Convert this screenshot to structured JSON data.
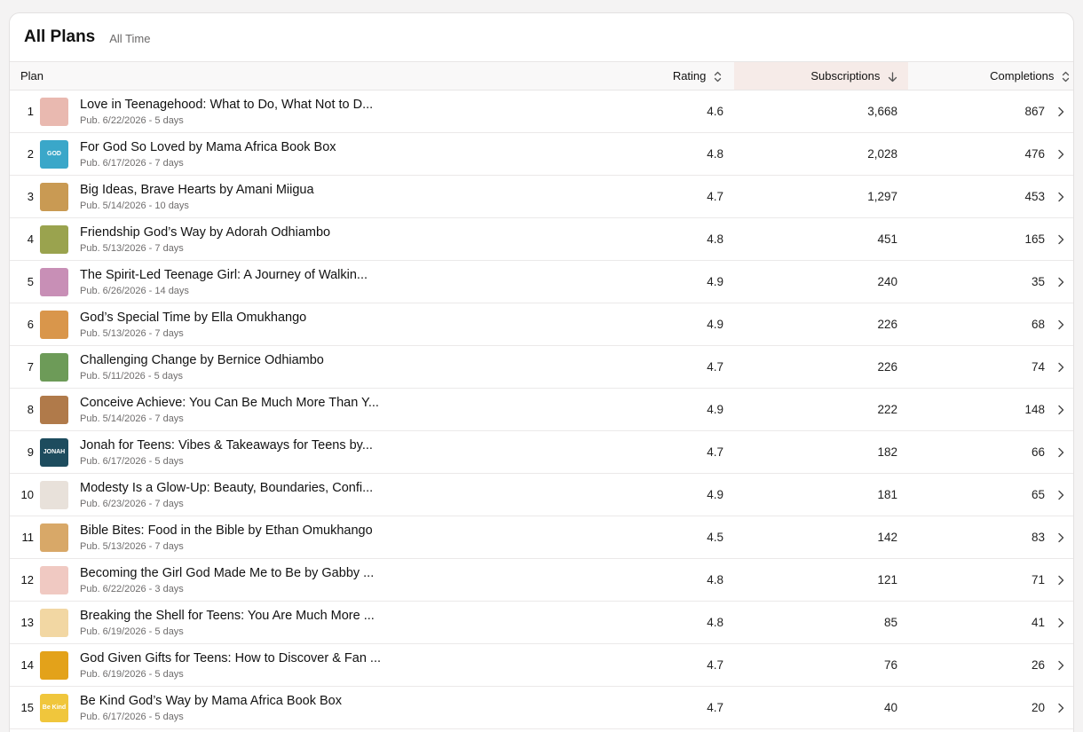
{
  "header": {
    "title": "All Plans",
    "range": "All Time"
  },
  "columns": {
    "plan": "Plan",
    "rating": "Rating",
    "subscriptions": "Subscriptions",
    "completions": "Completions"
  },
  "sort": {
    "column": "subscriptions",
    "direction": "descending"
  },
  "rows": [
    {
      "rank": "1",
      "title": "Love in Teenagehood: What to Do, What Not to D...",
      "meta": "Pub. 6/22/2026 - 5 days",
      "rating": "4.6",
      "subscriptions": "3,668",
      "completions": "867",
      "thumb_color": "#e9b9b0",
      "thumb_text": ""
    },
    {
      "rank": "2",
      "title": "For God So Loved by Mama Africa Book Box",
      "meta": "Pub. 6/17/2026 - 7 days",
      "rating": "4.8",
      "subscriptions": "2,028",
      "completions": "476",
      "thumb_color": "#3aa7c9",
      "thumb_text": "GOD"
    },
    {
      "rank": "3",
      "title": "Big Ideas, Brave Hearts by Amani Miigua",
      "meta": "Pub. 5/14/2026 - 10 days",
      "rating": "4.7",
      "subscriptions": "1,297",
      "completions": "453",
      "thumb_color": "#c99a53",
      "thumb_text": ""
    },
    {
      "rank": "4",
      "title": "Friendship God’s Way by Adorah Odhiambo",
      "meta": "Pub. 5/13/2026 - 7 days",
      "rating": "4.8",
      "subscriptions": "451",
      "completions": "165",
      "thumb_color": "#9aa34e",
      "thumb_text": ""
    },
    {
      "rank": "5",
      "title": "The Spirit-Led Teenage Girl: A Journey of Walkin...",
      "meta": "Pub. 6/26/2026 - 14 days",
      "rating": "4.9",
      "subscriptions": "240",
      "completions": "35",
      "thumb_color": "#c88fb6",
      "thumb_text": ""
    },
    {
      "rank": "6",
      "title": "God’s Special Time by Ella Omukhango",
      "meta": "Pub. 5/13/2026 - 7 days",
      "rating": "4.9",
      "subscriptions": "226",
      "completions": "68",
      "thumb_color": "#d9964b",
      "thumb_text": ""
    },
    {
      "rank": "7",
      "title": "Challenging Change by Bernice Odhiambo",
      "meta": "Pub. 5/11/2026 - 5 days",
      "rating": "4.7",
      "subscriptions": "226",
      "completions": "74",
      "thumb_color": "#6d9b58",
      "thumb_text": ""
    },
    {
      "rank": "8",
      "title": "Conceive Achieve: You Can Be Much More Than Y...",
      "meta": "Pub. 5/14/2026 - 7 days",
      "rating": "4.9",
      "subscriptions": "222",
      "completions": "148",
      "thumb_color": "#b07a4a",
      "thumb_text": ""
    },
    {
      "rank": "9",
      "title": "Jonah for Teens: Vibes & Takeaways for Teens by...",
      "meta": "Pub. 6/17/2026 - 5 days",
      "rating": "4.7",
      "subscriptions": "182",
      "completions": "66",
      "thumb_color": "#1d4c5e",
      "thumb_text": "JONAH"
    },
    {
      "rank": "10",
      "title": "Modesty Is a Glow-Up: Beauty, Boundaries, Confi...",
      "meta": "Pub. 6/23/2026 - 7 days",
      "rating": "4.9",
      "subscriptions": "181",
      "completions": "65",
      "thumb_color": "#e8e1da",
      "thumb_text": ""
    },
    {
      "rank": "11",
      "title": "Bible Bites: Food in the Bible by Ethan Omukhango",
      "meta": "Pub. 5/13/2026 - 7 days",
      "rating": "4.5",
      "subscriptions": "142",
      "completions": "83",
      "thumb_color": "#d8a868",
      "thumb_text": ""
    },
    {
      "rank": "12",
      "title": "Becoming the Girl God Made Me to Be by Gabby ...",
      "meta": "Pub. 6/22/2026 - 3 days",
      "rating": "4.8",
      "subscriptions": "121",
      "completions": "71",
      "thumb_color": "#f0c9c2",
      "thumb_text": ""
    },
    {
      "rank": "13",
      "title": "Breaking the Shell for Teens: You Are Much More ...",
      "meta": "Pub. 6/19/2026 - 5 days",
      "rating": "4.8",
      "subscriptions": "85",
      "completions": "41",
      "thumb_color": "#f2d7a3",
      "thumb_text": ""
    },
    {
      "rank": "14",
      "title": "God Given Gifts for Teens: How to Discover & Fan ...",
      "meta": "Pub. 6/19/2026 - 5 days",
      "rating": "4.7",
      "subscriptions": "76",
      "completions": "26",
      "thumb_color": "#e3a21a",
      "thumb_text": ""
    },
    {
      "rank": "15",
      "title": "Be Kind God’s Way by Mama Africa Book Box",
      "meta": "Pub. 6/17/2026 - 5 days",
      "rating": "4.7",
      "subscriptions": "40",
      "completions": "20",
      "thumb_color": "#f0c63c",
      "thumb_text": "Be Kind"
    }
  ]
}
